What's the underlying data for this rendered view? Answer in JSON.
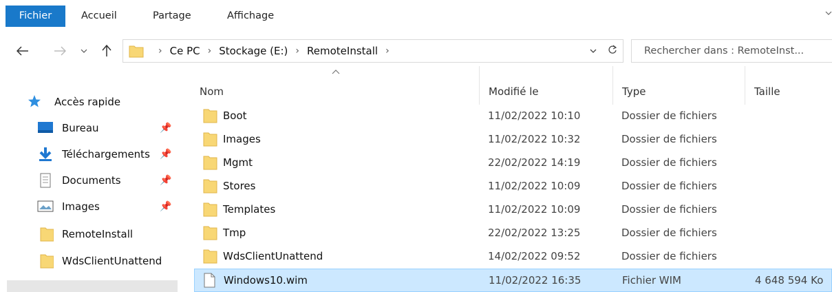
{
  "ribbon": {
    "tabs": [
      "Fichier",
      "Accueil",
      "Partage",
      "Affichage"
    ]
  },
  "address": {
    "crumbs": [
      "Ce PC",
      "Stockage (E:)",
      "RemoteInstall"
    ],
    "search_placeholder": "Rechercher dans : RemoteInst..."
  },
  "nav": {
    "quick_access": "Accès rapide",
    "items": [
      {
        "label": "Bureau",
        "icon": "desktop-icon",
        "pinned": true
      },
      {
        "label": "Téléchargements",
        "icon": "download-icon",
        "pinned": true
      },
      {
        "label": "Documents",
        "icon": "documents-icon",
        "pinned": true
      },
      {
        "label": "Images",
        "icon": "pictures-icon",
        "pinned": true
      },
      {
        "label": "RemoteInstall",
        "icon": "folder-icon",
        "pinned": false
      },
      {
        "label": "WdsClientUnattend",
        "icon": "folder-icon",
        "pinned": false
      }
    ]
  },
  "columns": {
    "name": "Nom",
    "modified": "Modifié le",
    "type": "Type",
    "size": "Taille"
  },
  "files": [
    {
      "name": "Boot",
      "modified": "11/02/2022 10:10",
      "type": "Dossier de fichiers",
      "size": "",
      "kind": "folder"
    },
    {
      "name": "Images",
      "modified": "11/02/2022 10:32",
      "type": "Dossier de fichiers",
      "size": "",
      "kind": "folder"
    },
    {
      "name": "Mgmt",
      "modified": "22/02/2022 14:19",
      "type": "Dossier de fichiers",
      "size": "",
      "kind": "folder"
    },
    {
      "name": "Stores",
      "modified": "11/02/2022 10:09",
      "type": "Dossier de fichiers",
      "size": "",
      "kind": "folder"
    },
    {
      "name": "Templates",
      "modified": "11/02/2022 10:09",
      "type": "Dossier de fichiers",
      "size": "",
      "kind": "folder"
    },
    {
      "name": "Tmp",
      "modified": "22/02/2022 13:25",
      "type": "Dossier de fichiers",
      "size": "",
      "kind": "folder"
    },
    {
      "name": "WdsClientUnattend",
      "modified": "14/02/2022 09:52",
      "type": "Dossier de fichiers",
      "size": "",
      "kind": "folder"
    },
    {
      "name": "Windows10.wim",
      "modified": "11/02/2022 16:35",
      "type": "Fichier WIM",
      "size": "4 648 594 Ko",
      "kind": "file",
      "selected": true
    }
  ],
  "colors": {
    "accent": "#1979ca",
    "selection": "#cce8ff",
    "folder": "#f8d775"
  }
}
